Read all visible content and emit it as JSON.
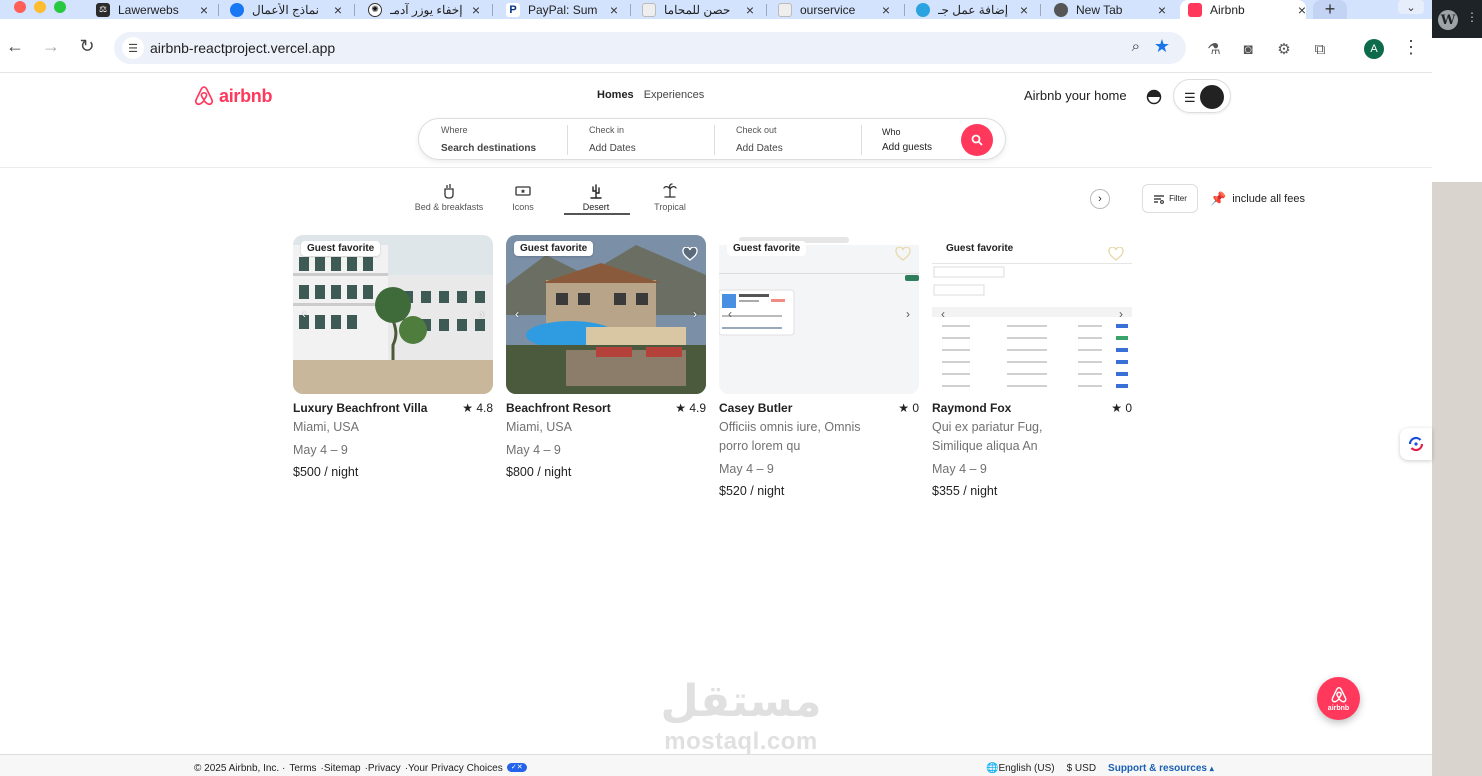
{
  "browser": {
    "tabs": [
      {
        "title": "Lawerwebs",
        "active": false
      },
      {
        "title": "نماذج الأعمال",
        "active": false
      },
      {
        "title": "إخفاء يوزر آدمـ",
        "active": false
      },
      {
        "title": "PayPal: Sum",
        "active": false
      },
      {
        "title": "حصن للمحاما",
        "active": false
      },
      {
        "title": "ourservice",
        "active": false
      },
      {
        "title": "إضافة عمل جـ",
        "active": false
      },
      {
        "title": "New Tab",
        "active": false
      },
      {
        "title": "Airbnb",
        "active": true
      }
    ],
    "new_tab_label": "+",
    "url": "airbnb-reactproject.vercel.app",
    "profile_initial": "A"
  },
  "header": {
    "logo_text": "airbnb",
    "nav": [
      "Homes",
      "Experiences"
    ],
    "host_link": "Airbnb your home"
  },
  "search": {
    "where_label": "Where",
    "where_placeholder": "Search destinations",
    "checkin_label": "Check in",
    "checkin_placeholder": "Add Dates",
    "checkout_label": "Check out",
    "checkout_placeholder": "Add Dates",
    "who_label": "Who",
    "who_placeholder": "Add guests"
  },
  "categories": [
    {
      "label": "Bed & breakfasts",
      "icon": "breakfast-icon",
      "active": false
    },
    {
      "label": "Icons",
      "icon": "ticket-icon",
      "active": false
    },
    {
      "label": "Desert",
      "icon": "cactus-icon",
      "active": true
    },
    {
      "label": "Tropical",
      "icon": "palm-icon",
      "active": false
    }
  ],
  "filter_label": "Filter",
  "fees_label": "include all fees",
  "listings": [
    {
      "badge": "Guest favorite",
      "name": "Luxury Beachfront Villa",
      "rating": "4.8",
      "desc": "Miami, USA",
      "dates": "May 4 – 9",
      "price": "$500 / night"
    },
    {
      "badge": "Guest favorite",
      "name": "Beachfront Resort",
      "rating": "4.9",
      "desc": "Miami, USA",
      "dates": "May 4 – 9",
      "price": "$800 / night"
    },
    {
      "badge": "Guest favorite",
      "name": "Casey Butler",
      "rating": "0",
      "desc": "Officiis omnis iure, Omnis porro lorem qu",
      "dates": "May 4 – 9",
      "price": "$520 / night"
    },
    {
      "badge": "Guest favorite",
      "name": "Raymond Fox",
      "rating": "0",
      "desc": "Qui ex pariatur Fug, Similique aliqua An",
      "dates": "May 4 – 9",
      "price": "$355 / night"
    }
  ],
  "fab_label": "airbnb",
  "watermark": {
    "arabic": "مستقل",
    "latin": "mostaql.com"
  },
  "footer": {
    "copyright": "© 2025 Airbnb, Inc. ·",
    "links": [
      "Terms",
      "·Sitemap",
      "·Privacy",
      "·Your Privacy Choices"
    ],
    "language": "English (US)",
    "currency": "$ USD",
    "support": "Support & resources"
  },
  "colors": {
    "brand": "#ff385c",
    "tabstrip": "#d3e3fd"
  }
}
